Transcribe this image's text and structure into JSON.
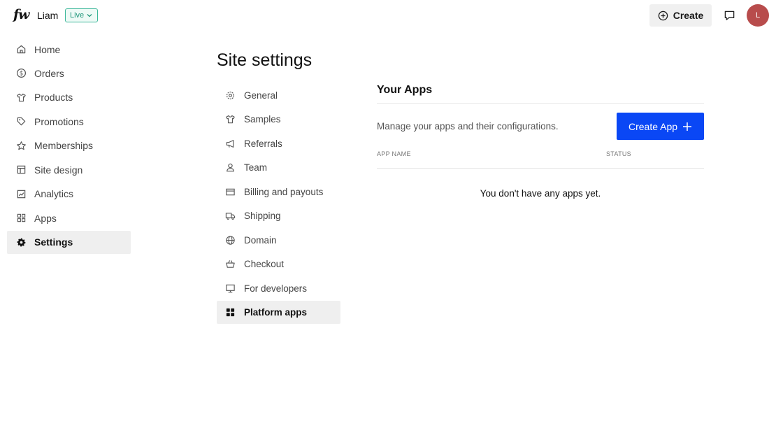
{
  "header": {
    "logo": "fw",
    "store_name": "Liam",
    "status_badge": "Live",
    "create_label": "Create",
    "avatar_initial": "L"
  },
  "sidebar": {
    "items": [
      {
        "label": "Home",
        "icon": "home-icon"
      },
      {
        "label": "Orders",
        "icon": "dollar-circle-icon"
      },
      {
        "label": "Products",
        "icon": "tshirt-icon"
      },
      {
        "label": "Promotions",
        "icon": "tag-icon"
      },
      {
        "label": "Memberships",
        "icon": "star-icon"
      },
      {
        "label": "Site design",
        "icon": "layout-icon"
      },
      {
        "label": "Analytics",
        "icon": "chart-icon"
      },
      {
        "label": "Apps",
        "icon": "grid-icon"
      },
      {
        "label": "Settings",
        "icon": "gear-icon",
        "active": true
      }
    ]
  },
  "page": {
    "title": "Site settings"
  },
  "settings_nav": {
    "items": [
      {
        "label": "General",
        "icon": "gear-icon"
      },
      {
        "label": "Samples",
        "icon": "tshirt-icon"
      },
      {
        "label": "Referrals",
        "icon": "megaphone-icon"
      },
      {
        "label": "Team",
        "icon": "user-icon"
      },
      {
        "label": "Billing and payouts",
        "icon": "card-icon"
      },
      {
        "label": "Shipping",
        "icon": "truck-icon"
      },
      {
        "label": "Domain",
        "icon": "globe-icon"
      },
      {
        "label": "Checkout",
        "icon": "basket-icon"
      },
      {
        "label": "For developers",
        "icon": "monitor-icon"
      },
      {
        "label": "Platform apps",
        "icon": "apps-filled-icon",
        "active": true
      }
    ]
  },
  "apps": {
    "section_title": "Your Apps",
    "description": "Manage your apps and their configurations.",
    "create_button": "Create App",
    "columns": {
      "name": "APP NAME",
      "status": "STATUS"
    },
    "empty_message": "You don't have any apps yet."
  },
  "colors": {
    "primary": "#0a47f5",
    "live_badge": "#23977c",
    "avatar": "#b84c4c",
    "active_bg": "#efefef"
  }
}
